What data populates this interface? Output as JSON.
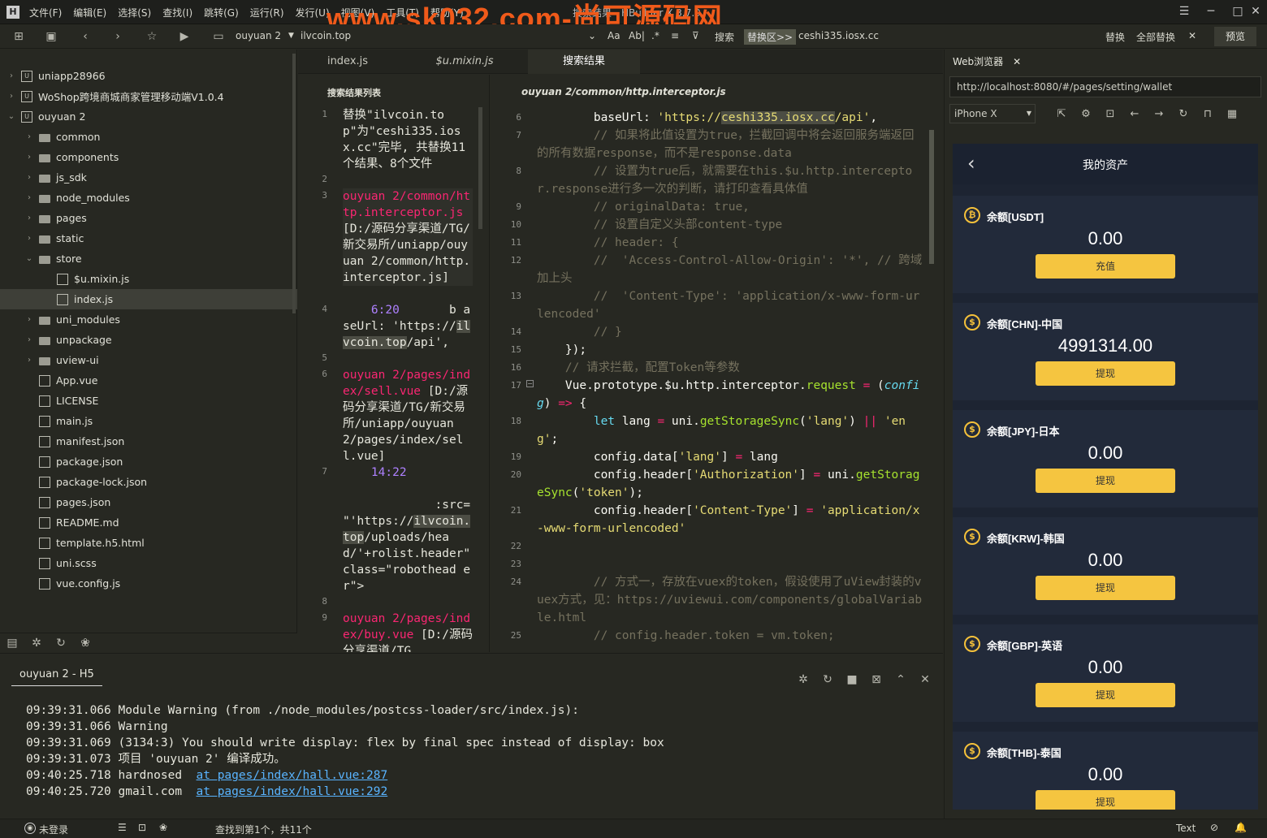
{
  "titlebar": {
    "menu": [
      "文件(F)",
      "编辑(E)",
      "选择(S)",
      "查找(I)",
      "跳转(G)",
      "运行(R)",
      "发行(U)",
      "视图(V)",
      "工具(T)",
      "帮助(Y)"
    ],
    "watermark": "www.sk032.com-尚可源码网",
    "title_fragment": "搜索结果 - HBuilder X 3.7.9"
  },
  "toolbar": {
    "project": "ouyuan 2",
    "search_term": "ilvcoin.top",
    "aa": "Aa",
    "ab": "Ab|",
    "search_label": "搜索",
    "replace_zone": "替换区>>",
    "replace_term": "ceshi335.iosx.cc",
    "replace": "替换",
    "replace_all": "全部替换",
    "preview": "预览"
  },
  "sidebar": {
    "items": [
      {
        "label": "uniapp28966",
        "depth": 0,
        "type": "project",
        "open": false
      },
      {
        "label": "WoShop跨境商城商家管理移动端V1.0.4",
        "depth": 0,
        "type": "project",
        "open": false
      },
      {
        "label": "ouyuan 2",
        "depth": 0,
        "type": "project",
        "open": true
      },
      {
        "label": "common",
        "depth": 1,
        "type": "folder",
        "open": false
      },
      {
        "label": "components",
        "depth": 1,
        "type": "folder",
        "open": false
      },
      {
        "label": "js_sdk",
        "depth": 1,
        "type": "folder",
        "open": false
      },
      {
        "label": "node_modules",
        "depth": 1,
        "type": "folder",
        "open": false
      },
      {
        "label": "pages",
        "depth": 1,
        "type": "folder",
        "open": false
      },
      {
        "label": "static",
        "depth": 1,
        "type": "folder",
        "open": false
      },
      {
        "label": "store",
        "depth": 1,
        "type": "folder",
        "open": true
      },
      {
        "label": "$u.mixin.js",
        "depth": 2,
        "type": "file"
      },
      {
        "label": "index.js",
        "depth": 2,
        "type": "file",
        "selected": true
      },
      {
        "label": "uni_modules",
        "depth": 1,
        "type": "folder",
        "open": false
      },
      {
        "label": "unpackage",
        "depth": 1,
        "type": "folder",
        "open": false
      },
      {
        "label": "uview-ui",
        "depth": 1,
        "type": "folder",
        "open": false
      },
      {
        "label": "App.vue",
        "depth": 1,
        "type": "file"
      },
      {
        "label": "LICENSE",
        "depth": 1,
        "type": "file"
      },
      {
        "label": "main.js",
        "depth": 1,
        "type": "file"
      },
      {
        "label": "manifest.json",
        "depth": 1,
        "type": "file"
      },
      {
        "label": "package.json",
        "depth": 1,
        "type": "file"
      },
      {
        "label": "package-lock.json",
        "depth": 1,
        "type": "file"
      },
      {
        "label": "pages.json",
        "depth": 1,
        "type": "file"
      },
      {
        "label": "README.md",
        "depth": 1,
        "type": "file"
      },
      {
        "label": "template.h5.html",
        "depth": 1,
        "type": "file"
      },
      {
        "label": "uni.scss",
        "depth": 1,
        "type": "file"
      },
      {
        "label": "vue.config.js",
        "depth": 1,
        "type": "file"
      }
    ]
  },
  "editor_tabs": [
    "index.js",
    "$u.mixin.js",
    "搜索结果"
  ],
  "search_pane": {
    "header": "搜索结果列表",
    "line_numbers": [
      "1",
      "2",
      "3",
      "4",
      "5",
      "6",
      "7",
      "8",
      "9"
    ],
    "summary": "替换\"ilvcoin.top\"为\"ceshi335.iosx.cc\"完毕, 共替换11个结果、8个文件",
    "file1": "ouyuan 2/common/http.interceptor.js",
    "file1_path": " [D:/源码分享渠道/TG/新交易所/uniapp/ouyuan 2/common/http.interceptor.js]",
    "m1_pos": "6:20",
    "m1_text": "b aseUrl: 'https://",
    "m1_hl": "ilvcoin.top",
    "m1_tail": "/api',",
    "file2": "ouyuan 2/pages/index/sell.vue",
    "file2_path": " [D:/源码分享渠道/TG/新交易所/uniapp/ouyuan 2/pages/index/sell.vue]",
    "m2_pos": "14:22",
    "m2_text": ":src= \"'https://",
    "m2_hl": "ilvcoin.top",
    "m2_tail": "/uploads/head/'+rolist.header\" class=\"robothead er\">",
    "file3": "ouyuan 2/pages/index/buy.vue",
    "file3_path": " [D:/源码分享渠道/TG..."
  },
  "code_pane": {
    "file_title": "ouyuan 2/common/http.interceptor.js",
    "lines": [
      {
        "n": "6",
        "html": "        baseUrl: <span class='st'>'https://<span class='hl'>ceshi335.iosx.cc</span>/api'</span>,"
      },
      {
        "n": "7",
        "html": "<span class='cm'>        // 如果将此值设置为true，拦截回调中将会返回服务端返回的所有数据response，而不是response.data</span>"
      },
      {
        "n": "8",
        "html": "<span class='cm'>        // 设置为true后，就需要在this.$u.http.interceptor.response进行多一次的判断，请打印查看具体值</span>"
      },
      {
        "n": "9",
        "html": "<span class='cm'>        // originalData: true,</span>"
      },
      {
        "n": "10",
        "html": "<span class='cm'>        // 设置自定义头部content-type</span>"
      },
      {
        "n": "11",
        "html": "<span class='cm'>        // header: {</span>"
      },
      {
        "n": "12",
        "html": "<span class='cm'>        //  'Access-Control-Allow-Origin': '*', // 跨域加上头</span>"
      },
      {
        "n": "13",
        "html": "<span class='cm'>        //  'Content-Type': 'application/x-www-form-urlencoded'</span>"
      },
      {
        "n": "14",
        "html": "<span class='cm'>        // }</span>"
      },
      {
        "n": "15",
        "html": "    });"
      },
      {
        "n": "16",
        "html": "<span class='cm'>    // 请求拦截，配置Token等参数</span>"
      },
      {
        "n": "17",
        "html": "    Vue.prototype.$u.http.interceptor.<span class='fn'>request</span> <span class='op'>=</span> (<span class='kw'><i>config</i></span>) <span class='op'>=&gt;</span> {"
      },
      {
        "n": "18",
        "html": "        <span class='kw'>let</span> lang <span class='op'>=</span> uni.<span class='fn'>getStorageSync</span>(<span class='st'>'lang'</span>) <span class='op'>||</span> <span class='st'>'eng'</span>;"
      },
      {
        "n": "19",
        "html": "        config.data[<span class='st'>'lang'</span>] <span class='op'>=</span> lang"
      },
      {
        "n": "20",
        "html": "        config.header[<span class='st'>'Authorization'</span>] <span class='op'>=</span> uni.<span class='fn'>getStorageSync</span>(<span class='st'>'token'</span>);"
      },
      {
        "n": "21",
        "html": "        config.header[<span class='st'>'Content-Type'</span>] <span class='op'>=</span> <span class='st'>'application/x-www-form-urlencoded'</span>"
      },
      {
        "n": "22",
        "html": ""
      },
      {
        "n": "23",
        "html": ""
      },
      {
        "n": "24",
        "html": "<span class='cm'>        // 方式一，存放在vuex的token，假设使用了uView封装的vuex方式，见：https://uviewui.com/components/globalVariable.html</span>"
      },
      {
        "n": "25",
        "html": "<span class='cm'>        // config.header.token = vm.token;</span>"
      }
    ]
  },
  "console": {
    "tab": "ouyuan 2 - H5",
    "lines": [
      {
        "text": "09:39:31.066 Module Warning (from ./node_modules/postcss-loader/src/index.js):",
        "link": ""
      },
      {
        "text": "09:39:31.066 Warning",
        "link": ""
      },
      {
        "text": "09:39:31.069 (3134:3) You should write display: flex by final spec instead of display: box",
        "link": ""
      },
      {
        "text": "09:39:31.073 项目 'ouyuan 2' 编译成功。",
        "link": ""
      },
      {
        "text": "09:40:25.718 hardnosed  ",
        "link": "at pages/index/hall.vue:287"
      },
      {
        "text": "09:40:25.720 gmail.com  ",
        "link": "at pages/index/hall.vue:292"
      }
    ]
  },
  "statusbar": {
    "login": "未登录",
    "find": "查找到第1个，共11个",
    "text_mode": "Text"
  },
  "browser": {
    "tab": "Web浏览器",
    "url": "http://localhost:8080/#/pages/setting/wallet",
    "device": "iPhone X",
    "page_title": "我的资产",
    "cards": [
      {
        "name": "余额[USDT]",
        "value": "0.00",
        "button": "充值",
        "icon": "₿"
      },
      {
        "name": "余额[CHN]-中国",
        "value": "4991314.00",
        "button": "提现",
        "icon": "$"
      },
      {
        "name": "余额[JPY]-日本",
        "value": "0.00",
        "button": "提现",
        "icon": "$"
      },
      {
        "name": "余额[KRW]-韩国",
        "value": "0.00",
        "button": "提现",
        "icon": "$"
      },
      {
        "name": "余额[GBP]-英语",
        "value": "0.00",
        "button": "提现",
        "icon": "$"
      },
      {
        "name": "余额[THB]-泰国",
        "value": "0.00",
        "button": "提现",
        "icon": "$"
      }
    ]
  }
}
